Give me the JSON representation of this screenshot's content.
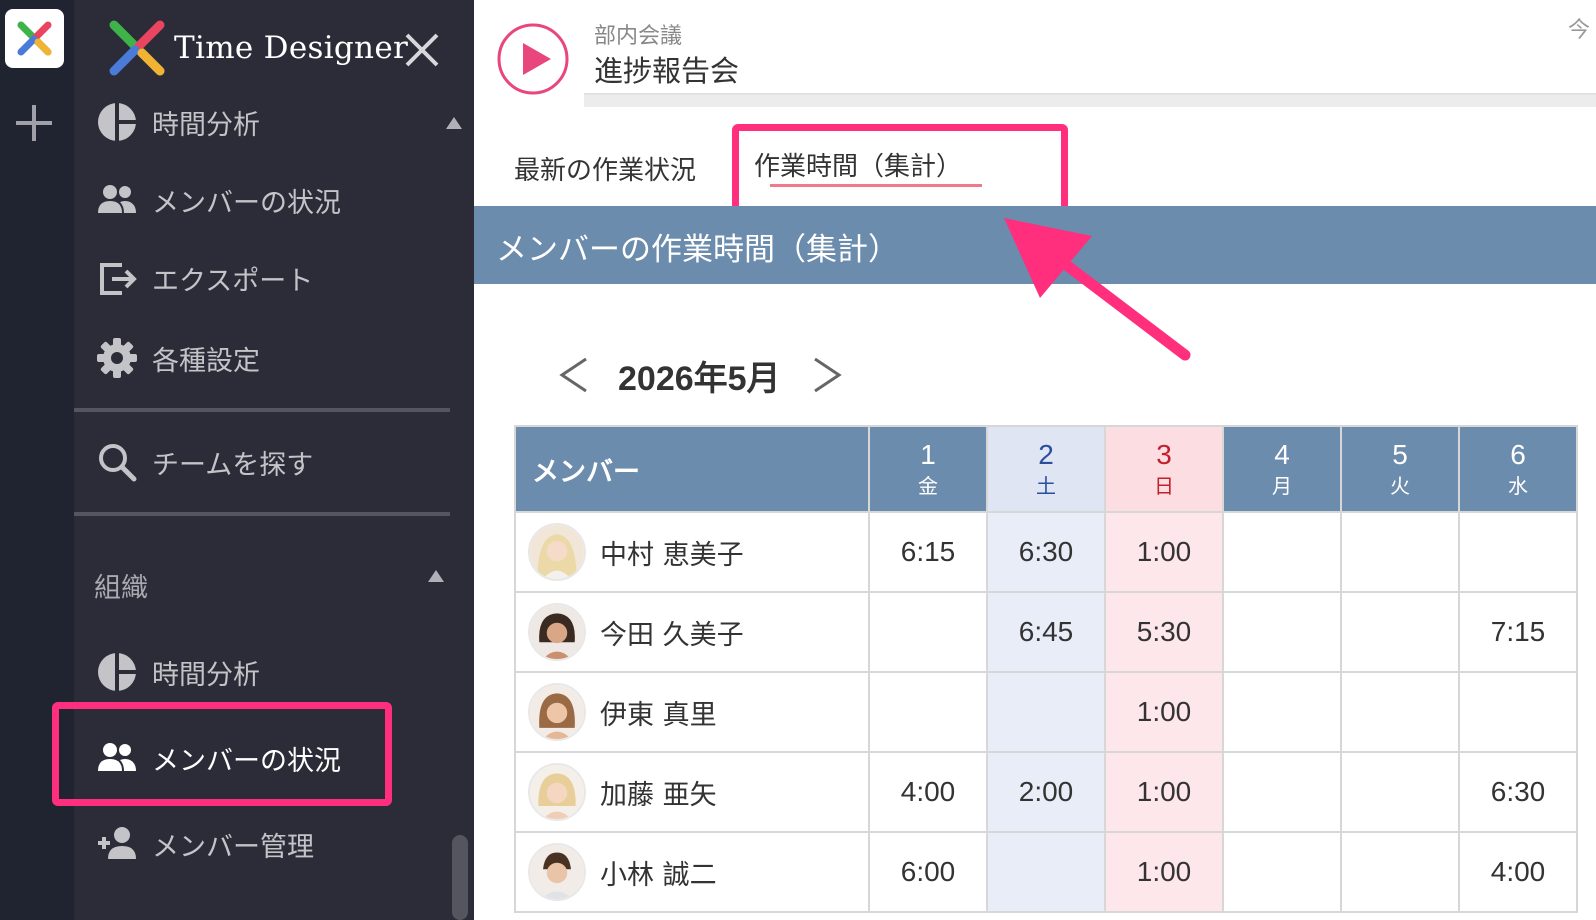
{
  "app": {
    "name": "Time Designer",
    "colors": {
      "sidebar_bg": "#2c2c38",
      "rail_bg": "#202430",
      "section_bar": "#6c8cad",
      "highlight": "#ff2f7e",
      "play": "#e8467c"
    }
  },
  "sidebar": {
    "items": [
      {
        "label": "時間分析",
        "icon": "pie-chart-icon"
      },
      {
        "label": "メンバーの状況",
        "icon": "people-icon"
      },
      {
        "label": "エクスポート",
        "icon": "export-icon"
      },
      {
        "label": "各種設定",
        "icon": "gear-icon"
      }
    ],
    "search_label": "チームを探す",
    "org_section": {
      "label": "組織",
      "items": [
        {
          "label": "時間分析",
          "icon": "pie-chart-icon"
        },
        {
          "label": "メンバーの状況",
          "icon": "people-icon"
        },
        {
          "label": "メンバー管理",
          "icon": "add-person-icon"
        }
      ]
    }
  },
  "header": {
    "breadcrumb": "部内会議",
    "title": "進捗報告会",
    "top_right": "今"
  },
  "tabs": [
    {
      "label": "最新の作業状況",
      "active": false
    },
    {
      "label": "作業時間（集計）",
      "active": true
    }
  ],
  "section_title": "メンバーの作業時間（集計）",
  "month": {
    "label": "2026年5月"
  },
  "table": {
    "member_header": "メンバー",
    "days": [
      {
        "num": "1",
        "wk": "金",
        "type": "weekday"
      },
      {
        "num": "2",
        "wk": "土",
        "type": "sat"
      },
      {
        "num": "3",
        "wk": "日",
        "type": "sun"
      },
      {
        "num": "4",
        "wk": "月",
        "type": "weekday"
      },
      {
        "num": "5",
        "wk": "火",
        "type": "weekday"
      },
      {
        "num": "6",
        "wk": "水",
        "type": "weekday"
      }
    ],
    "rows": [
      {
        "name": "中村 恵美子",
        "values": [
          "6:15",
          "6:30",
          "1:00",
          "",
          "",
          ""
        ]
      },
      {
        "name": "今田 久美子",
        "values": [
          "",
          "6:45",
          "5:30",
          "",
          "",
          "7:15"
        ]
      },
      {
        "name": "伊東 真里",
        "values": [
          "",
          "",
          "1:00",
          "",
          "",
          ""
        ]
      },
      {
        "name": "加藤 亜矢",
        "values": [
          "4:00",
          "2:00",
          "1:00",
          "",
          "",
          "6:30"
        ]
      },
      {
        "name": "小林 誠二",
        "values": [
          "6:00",
          "",
          "1:00",
          "",
          "",
          "4:00"
        ]
      }
    ]
  }
}
